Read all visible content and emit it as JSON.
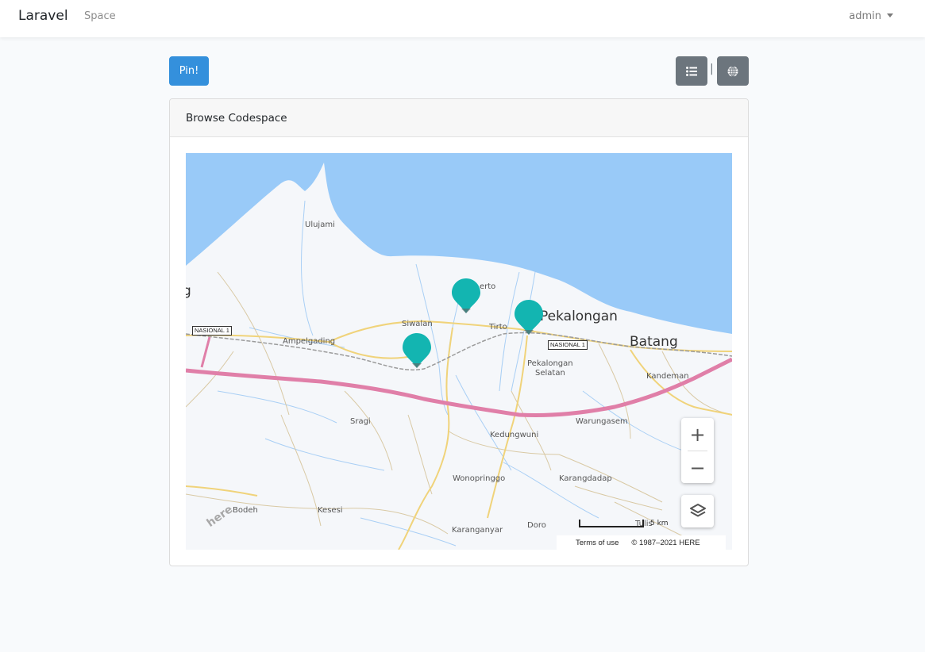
{
  "navbar": {
    "brand": "Laravel",
    "nav_link": "Space",
    "user_menu": "admin"
  },
  "toolbar": {
    "pin_label": "Pin!",
    "list_icon": "list-icon",
    "globe_icon": "globe-icon",
    "separator": "|"
  },
  "card": {
    "header": "Browse Codespace"
  },
  "map": {
    "places": [
      {
        "name": "Ulujami"
      },
      {
        "name": "g"
      },
      {
        "name": "Siwalan"
      },
      {
        "name": "Tirto"
      },
      {
        "name": "erto"
      },
      {
        "name": "Pekalongan"
      },
      {
        "name": "Batang"
      },
      {
        "name": "Ampelgading"
      },
      {
        "name": "Pekalongan"
      },
      {
        "name": "Selatan"
      },
      {
        "name": "Kandeman"
      },
      {
        "name": "Sragi"
      },
      {
        "name": "Warungasem"
      },
      {
        "name": "Kedungwuni"
      },
      {
        "name": "Wonopringgo"
      },
      {
        "name": "Karangdadap"
      },
      {
        "name": "Bodeh"
      },
      {
        "name": "Kesesi"
      },
      {
        "name": "Karanganyar"
      },
      {
        "name": "Doro"
      },
      {
        "name": "Tulis"
      }
    ],
    "road_shield": "NASIONAL 1",
    "zoom_in": "+",
    "zoom_out": "−",
    "scale": "5 km",
    "terms": "Terms of use",
    "copyright": "© 1987–2021 HERE",
    "logo": "here",
    "marker_color": "#13b5b1",
    "sea_color": "#99caf8",
    "highway_color": "#e07fa8"
  }
}
